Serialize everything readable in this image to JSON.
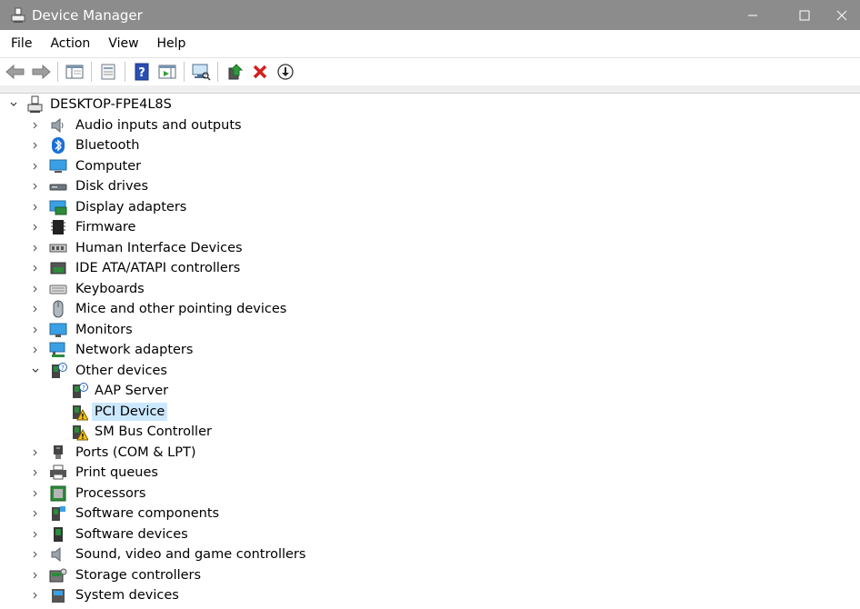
{
  "window": {
    "title": "Device Manager"
  },
  "menu": [
    "File",
    "Action",
    "View",
    "Help"
  ],
  "toolbar": {
    "buttons": [
      "back-icon",
      "forward-icon",
      "show-hide-console-tree-icon",
      "properties-icon",
      "help-icon",
      "action-pane-icon",
      "scan-hardware-icon",
      "update-driver-icon",
      "uninstall-icon",
      "disable-device-icon"
    ]
  },
  "tree": {
    "root": "DESKTOP-FPE4L8S",
    "categories": [
      {
        "label": "Audio inputs and outputs",
        "icon": "speaker-icon"
      },
      {
        "label": "Bluetooth",
        "icon": "bluetooth-icon"
      },
      {
        "label": "Computer",
        "icon": "computer-icon"
      },
      {
        "label": "Disk drives",
        "icon": "disk-drive-icon"
      },
      {
        "label": "Display adapters",
        "icon": "display-adapter-icon"
      },
      {
        "label": "Firmware",
        "icon": "firmware-chip-icon"
      },
      {
        "label": "Human Interface Devices",
        "icon": "hid-icon"
      },
      {
        "label": "IDE ATA/ATAPI controllers",
        "icon": "ide-controller-icon"
      },
      {
        "label": "Keyboards",
        "icon": "keyboard-icon"
      },
      {
        "label": "Mice and other pointing devices",
        "icon": "mouse-icon"
      },
      {
        "label": "Monitors",
        "icon": "monitor-icon"
      },
      {
        "label": "Network adapters",
        "icon": "network-adapter-icon"
      },
      {
        "label": "Other devices",
        "icon": "other-devices-icon",
        "expanded": true
      },
      {
        "label": "Ports (COM & LPT)",
        "icon": "port-icon"
      },
      {
        "label": "Print queues",
        "icon": "printer-icon"
      },
      {
        "label": "Processors",
        "icon": "processor-icon"
      },
      {
        "label": "Software components",
        "icon": "software-component-icon"
      },
      {
        "label": "Software devices",
        "icon": "software-device-icon"
      },
      {
        "label": "Sound, video and game controllers",
        "icon": "sound-controller-icon"
      },
      {
        "label": "Storage controllers",
        "icon": "storage-controller-icon"
      },
      {
        "label": "System devices",
        "icon": "system-devices-icon"
      }
    ],
    "other_devices_children": [
      {
        "label": "AAP Server",
        "icon": "unknown-device-icon"
      },
      {
        "label": "PCI Device",
        "icon": "warning-device-icon",
        "selected": true
      },
      {
        "label": "SM Bus Controller",
        "icon": "warning-device-icon"
      }
    ]
  },
  "colors": {
    "titlebar": "#8c8c8c",
    "selection": "#cce8ff"
  }
}
